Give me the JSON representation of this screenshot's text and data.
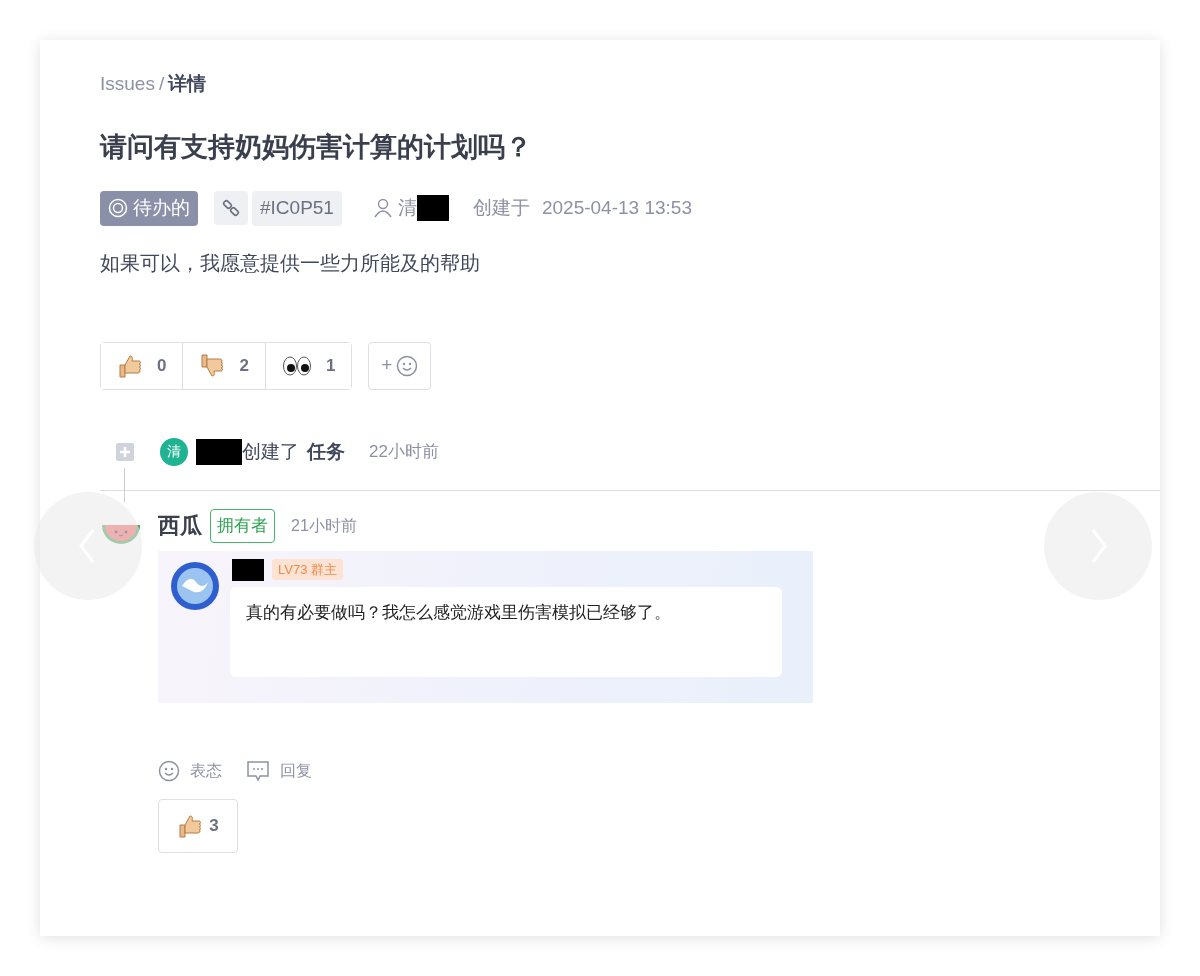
{
  "breadcrumb": [
    {
      "label": "Issues",
      "current": false
    },
    {
      "label": "详情",
      "current": true
    }
  ],
  "breadcrumb_separator": "/",
  "title": "请问有支持奶妈伤害计算的计划吗？",
  "meta": {
    "status": "待办的",
    "issue_number": "#IC0P51",
    "author": "清",
    "created_label": "创建于",
    "created_at": "2025-04-13 13:53"
  },
  "body": "如果可以，我愿意提供一些力所能及的帮助",
  "reactions": [
    {
      "kind": "thumbs_up",
      "count": "0"
    },
    {
      "kind": "thumbs_down",
      "count": "2"
    },
    {
      "kind": "eyes",
      "count": "1"
    }
  ],
  "add_reaction": "+",
  "event": {
    "avatar": "清",
    "action": "创建了",
    "object": "任务",
    "time": "22小时前"
  },
  "comment": {
    "author": "西瓜",
    "role": "拥有者",
    "time": "21小时前",
    "embedded": {
      "badge": "LV73 群主",
      "message": "真的有必要做吗？我怎么感觉游戏里伤害模拟已经够了。"
    },
    "actions": [
      {
        "kind": "react",
        "label": "表态"
      },
      {
        "kind": "reply",
        "label": "回复"
      }
    ],
    "reactions": [
      {
        "kind": "thumbs_up",
        "count": "3"
      }
    ]
  }
}
